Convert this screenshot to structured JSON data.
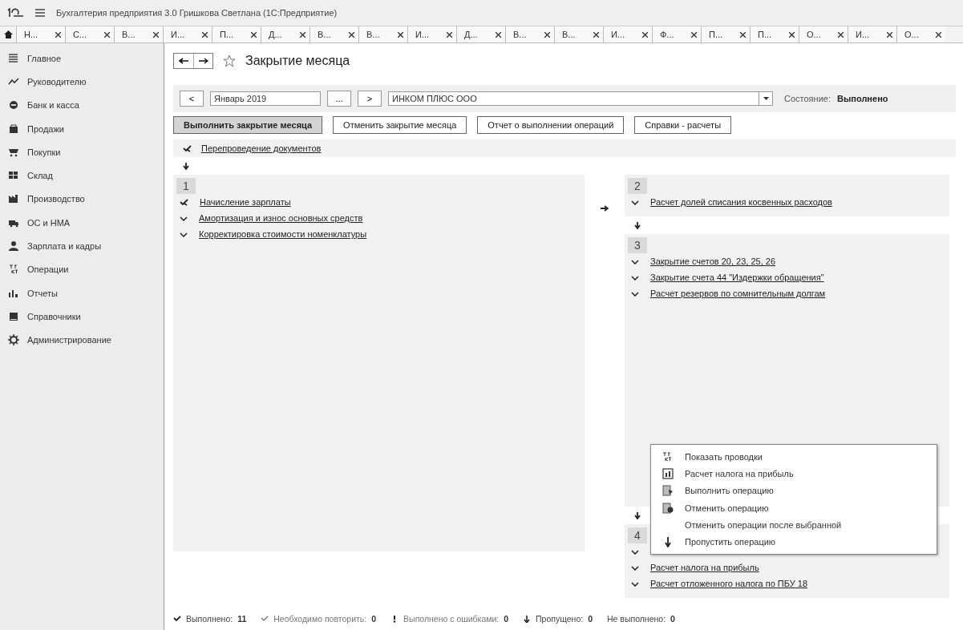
{
  "app": {
    "title": "Бухгалтерия предприятия 3.0 Гришкова Светлана  (1С:Предприятие)"
  },
  "tabs": [
    {
      "label": "Н..."
    },
    {
      "label": "С..."
    },
    {
      "label": "В..."
    },
    {
      "label": "И..."
    },
    {
      "label": "П..."
    },
    {
      "label": "Д..."
    },
    {
      "label": "В..."
    },
    {
      "label": "В..."
    },
    {
      "label": "И..."
    },
    {
      "label": "Д..."
    },
    {
      "label": "В..."
    },
    {
      "label": "В..."
    },
    {
      "label": "И..."
    },
    {
      "label": "Ф..."
    },
    {
      "label": "П..."
    },
    {
      "label": "П..."
    },
    {
      "label": "О..."
    },
    {
      "label": "И..."
    },
    {
      "label": "О..."
    }
  ],
  "sidebar": {
    "items": [
      {
        "label": "Главное"
      },
      {
        "label": "Руководителю"
      },
      {
        "label": "Банк и касса"
      },
      {
        "label": "Продажи"
      },
      {
        "label": "Покупки"
      },
      {
        "label": "Склад"
      },
      {
        "label": "Производство"
      },
      {
        "label": "ОС и НМА"
      },
      {
        "label": "Зарплата и кадры"
      },
      {
        "label": "Операции"
      },
      {
        "label": "Отчеты"
      },
      {
        "label": "Справочники"
      },
      {
        "label": "Администрирование"
      }
    ]
  },
  "form": {
    "title": "Закрытие месяца",
    "prev": "<",
    "period": "Январь 2019",
    "choose": "...",
    "next": ">",
    "organization": "ИНКОМ ПЛЮС ООО",
    "state_label": "Состояние:",
    "state_value": "Выполнено",
    "buttons": [
      {
        "label": "Выполнить закрытие месяца",
        "primary": true
      },
      {
        "label": "Отменить закрытие месяца",
        "primary": false
      },
      {
        "label": "Отчет о выполнении операций",
        "primary": false
      },
      {
        "label": "Справки - расчеты",
        "primary": false
      }
    ],
    "pre_operation": {
      "label": "Перепроведение документов",
      "kind": "double"
    },
    "groups": [
      {
        "number": "1",
        "operations": [
          {
            "label": "Начисление зарплаты",
            "kind": "double"
          },
          {
            "label": "Амортизация и износ основных средств",
            "kind": "single"
          },
          {
            "label": "Корректировка стоимости номенклатуры",
            "kind": "single"
          }
        ]
      },
      {
        "number": "2",
        "operations": [
          {
            "label": "Расчет долей списания косвенных расходов",
            "kind": "single"
          }
        ]
      },
      {
        "number": "3",
        "operations": [
          {
            "label": "Закрытие счетов 20, 23, 25, 26",
            "kind": "single"
          },
          {
            "label": "Закрытие счета 44 \"Издержки обращения\"",
            "kind": "single"
          },
          {
            "label": "Расчет резервов по сомнительным долгам",
            "kind": "single"
          }
        ]
      },
      {
        "number": "4",
        "operations": [
          {
            "kind": "single"
          },
          {
            "label": "Расчет налога на прибыль",
            "kind": "single"
          },
          {
            "label": "Расчет отложенного налога по ПБУ 18",
            "kind": "single"
          }
        ]
      }
    ]
  },
  "context_menu": {
    "items": [
      {
        "label": "Показать проводки",
        "kind": "postings"
      },
      {
        "label": "Расчет налога на прибыль",
        "kind": "report"
      },
      {
        "label": "Выполнить операцию",
        "kind": "run"
      },
      {
        "label": "Отменить операцию",
        "kind": "cancel"
      },
      {
        "label": "Отменить операции после выбранной",
        "kind": "plain"
      },
      {
        "label": "Пропустить операцию",
        "kind": "skip"
      }
    ]
  },
  "status_bar": {
    "items": [
      {
        "label": "Выполнено:",
        "value": "11",
        "kind": "done"
      },
      {
        "label": "Необходимо повторить:",
        "value": "0",
        "kind": "repeat"
      },
      {
        "label": "Выполнено с ошибками:",
        "value": "0",
        "kind": "error"
      },
      {
        "label": "Пропущено:",
        "value": "0",
        "kind": "skipped"
      },
      {
        "label": "Не выполнено:",
        "value": "0",
        "kind": "plain"
      }
    ]
  }
}
